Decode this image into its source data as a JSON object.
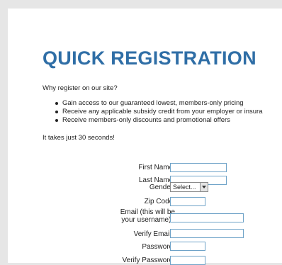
{
  "title": "QUICK REGISTRATION",
  "intro": "Why register on our site?",
  "benefits": [
    "Gain access to our guaranteed lowest, members-only pricing",
    "Receive any applicable subsidy credit from your employer or insura",
    "Receive members-only discounts and promotional offers"
  ],
  "time_note": "It takes just 30 seconds!",
  "form": {
    "first_name_label": "First Name:",
    "first_name_value": "",
    "last_name_label": "Last Name:",
    "last_name_value": "",
    "gender_label": "Gender:",
    "gender_selected": "Select...",
    "zip_label": "Zip Code:",
    "zip_value": "",
    "email_label_line1": "Email (this will be",
    "email_label_line2": "your username) :",
    "email_value": "",
    "verify_email_label": "Verify Email :",
    "verify_email_value": "",
    "password_label": "Password:",
    "password_value": "",
    "verify_password_label": "Verify Password:",
    "verify_password_value": ""
  },
  "colors": {
    "title": "#2f6ea6",
    "input_border": "#6fa3c8",
    "background": "#e6e6e6"
  },
  "icons": {
    "select_arrow": "chevron-down-icon"
  }
}
